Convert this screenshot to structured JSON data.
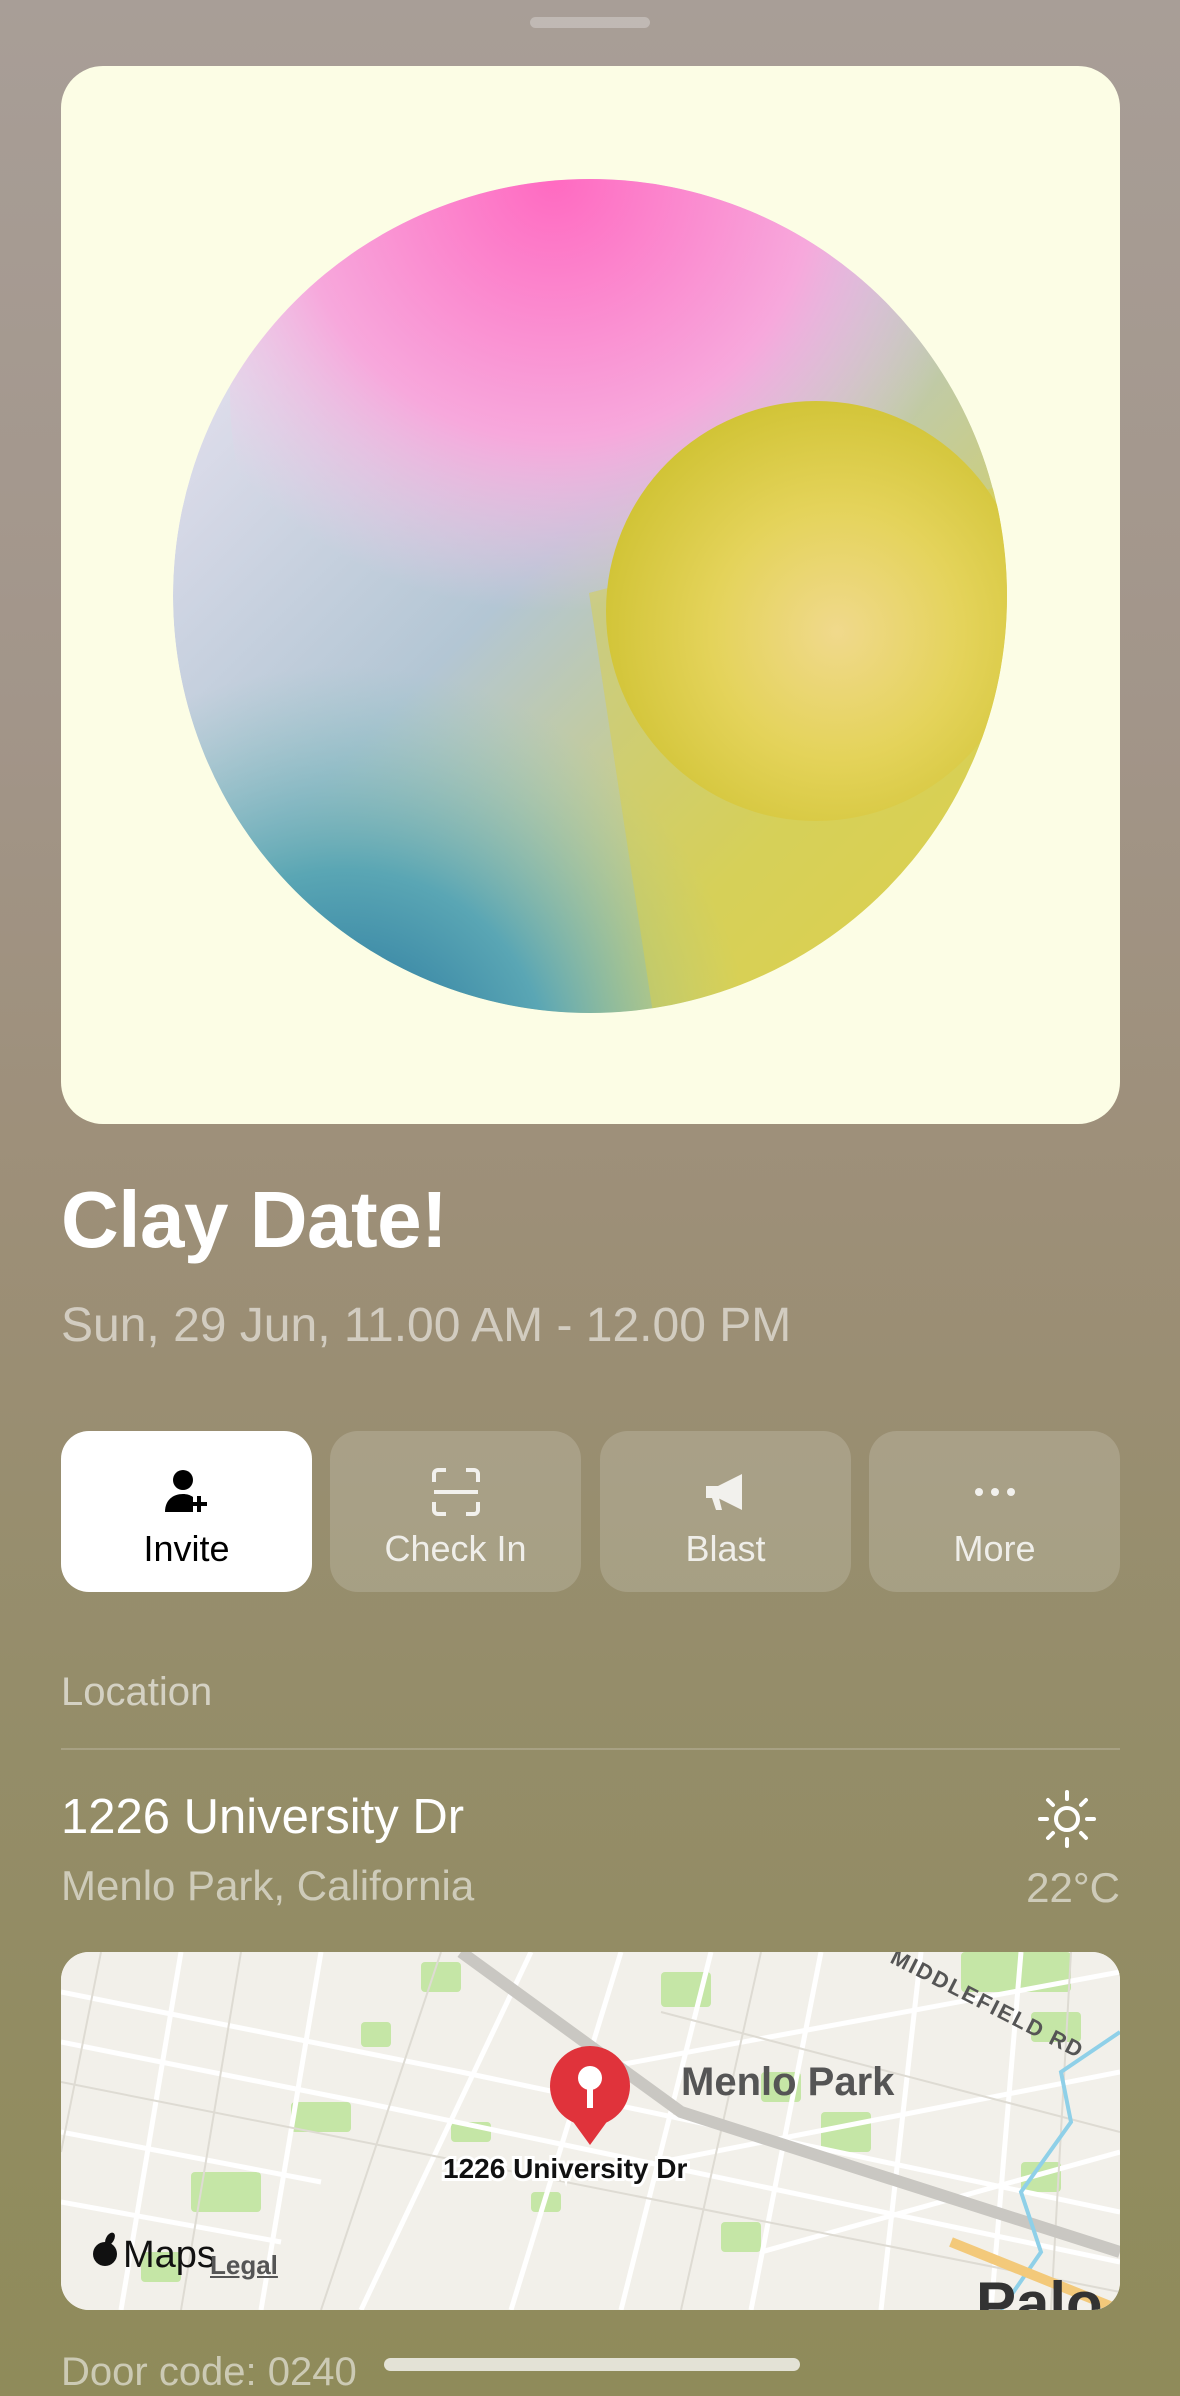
{
  "event": {
    "title": "Clay Date!",
    "datetime": "Sun, 29 Jun, 11.00 AM - 12.00 PM"
  },
  "actions": [
    {
      "label": "Invite",
      "icon": "person-add-icon"
    },
    {
      "label": "Check In",
      "icon": "qr-scan-icon"
    },
    {
      "label": "Blast",
      "icon": "megaphone-icon"
    },
    {
      "label": "More",
      "icon": "ellipsis-icon"
    }
  ],
  "location": {
    "section_label": "Location",
    "address_line1": "1226 University Dr",
    "address_line2": "Menlo Park, California",
    "weather_icon": "sun-icon",
    "temperature": "22°C"
  },
  "map": {
    "pin_label": "1226 University Dr",
    "city_label": "Menlo Park",
    "street_label": "MIDDLEFIELD RD",
    "partial_label": "Palo",
    "brand": "Maps",
    "legal": "Legal"
  },
  "door_code": "Door code: 0240",
  "colors": {
    "card_bg": "#fcfde5",
    "pin_red": "#e0333b",
    "park_green": "#c5e6a6"
  }
}
